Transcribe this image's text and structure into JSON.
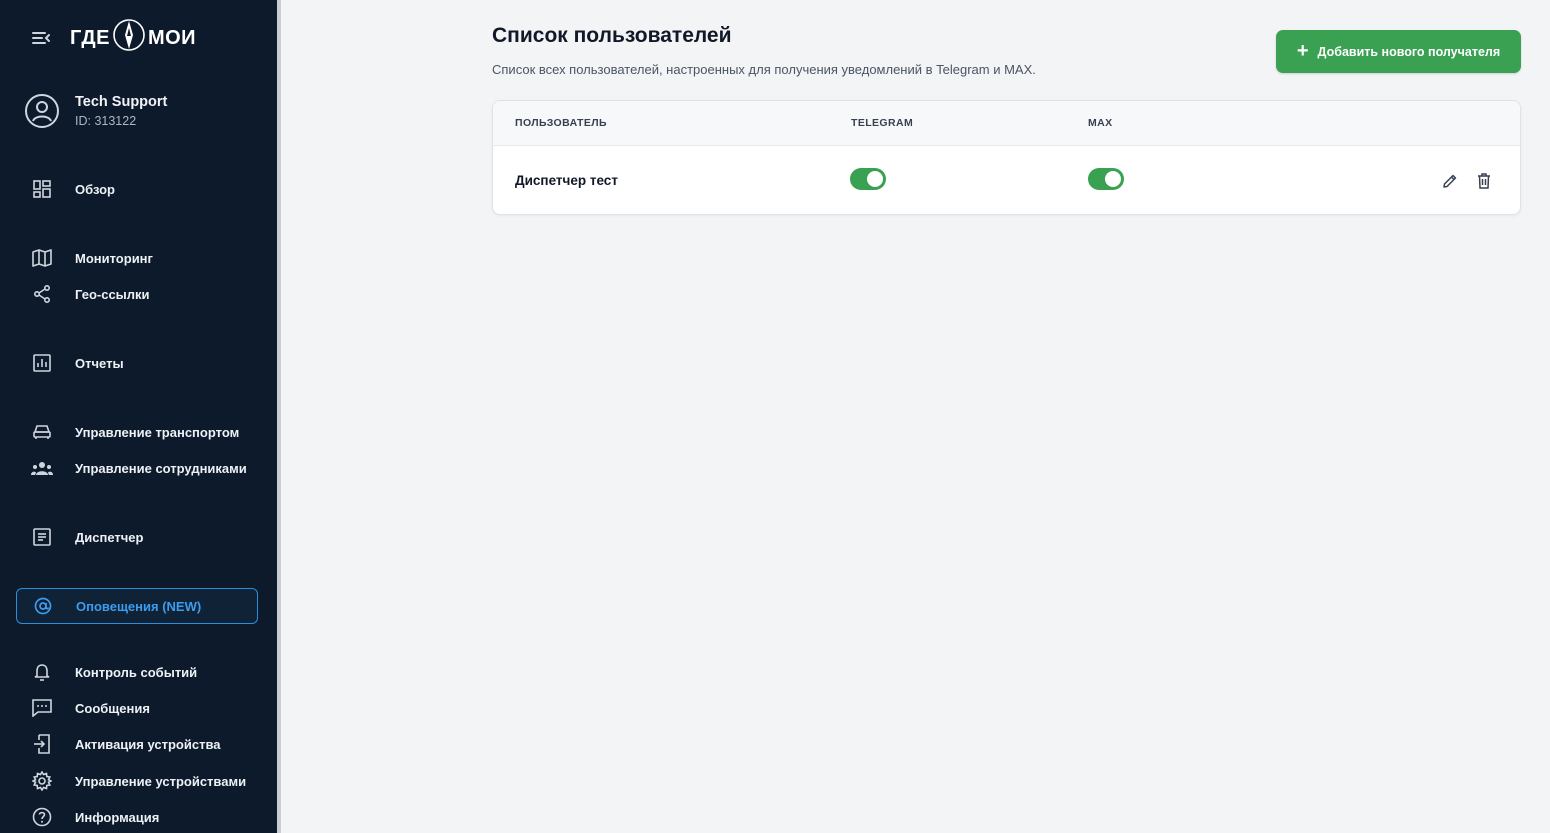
{
  "app": {
    "logo_text_left": "ГДЕ",
    "logo_text_right": "МОИ"
  },
  "profile": {
    "name": "Tech Support",
    "id_text": "ID: 313122"
  },
  "sidebar": {
    "items": [
      {
        "label": "Обзор",
        "icon": "dashboard-icon"
      },
      {
        "label": "Мониторинг",
        "icon": "map-icon"
      },
      {
        "label": "Гео-ссылки",
        "icon": "share-icon"
      },
      {
        "label": "Отчеты",
        "icon": "report-chart-icon"
      },
      {
        "label": "Управление транспортом",
        "icon": "car-icon"
      },
      {
        "label": "Управление сотрудниками",
        "icon": "people-icon"
      },
      {
        "label": "Диспетчер",
        "icon": "document-icon"
      },
      {
        "label": "Оповещения (NEW)",
        "icon": "at-sign-icon",
        "active": true
      },
      {
        "label": "Контроль событий",
        "icon": "bell-icon"
      },
      {
        "label": "Сообщения",
        "icon": "chat-icon"
      },
      {
        "label": "Активация устройства",
        "icon": "device-login-icon"
      },
      {
        "label": "Управление устройствами",
        "icon": "gear-icon"
      },
      {
        "label": "Информация",
        "icon": "help-circle-icon"
      }
    ]
  },
  "main": {
    "title": "Список пользователей",
    "subtitle": "Список всех пользователей, настроенных для получения уведомлений в Telegram и MAX.",
    "add_button_label": "Добавить нового получателя"
  },
  "table": {
    "columns": [
      "ПОЛЬЗОВАТЕЛЬ",
      "TELEGRAM",
      "MAX"
    ],
    "rows": [
      {
        "name": "Диспетчер тест",
        "telegram_enabled": true,
        "max_enabled": true
      }
    ]
  },
  "colors": {
    "sidebar_bg": "#0c1a2b",
    "accent_green": "#3aa152",
    "active_blue": "#2b8fe0",
    "page_bg": "#f3f4f6"
  }
}
